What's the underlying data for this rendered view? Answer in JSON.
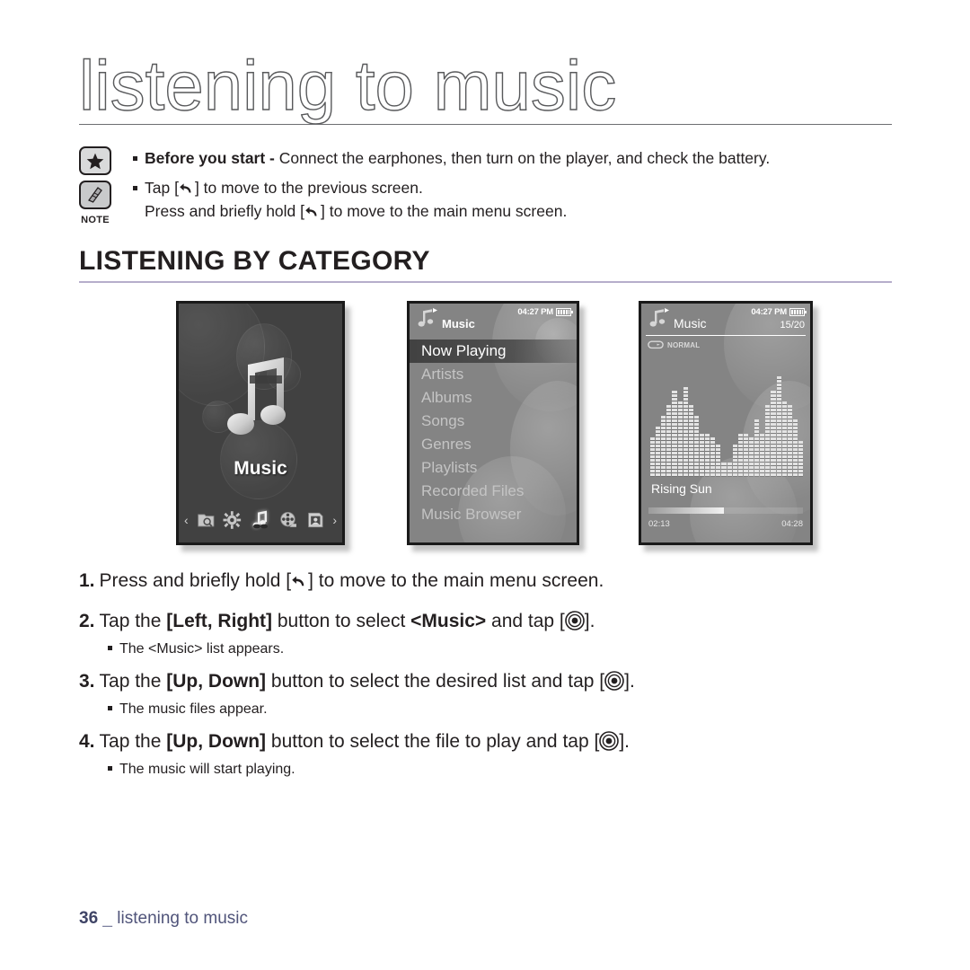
{
  "page": {
    "title": "listening to music",
    "section_heading": "LISTENING BY CATEGORY",
    "accent_rule_color": "#b6aecb"
  },
  "notes": {
    "caption": "NOTE",
    "star_icon": "star-icon",
    "pen_icon": "pen-note-icon",
    "items": [
      {
        "bold_lead": "Before you start -",
        "text": " Connect the earphones, then turn on the player, and check the battery."
      },
      {
        "pre": "Tap [",
        "post": "] to move to the previous screen.",
        "line2_pre": "Press and briefly hold [",
        "line2_post": "] to move to the main menu screen."
      }
    ]
  },
  "screens": {
    "main_menu": {
      "label": "Music",
      "icon_bar": [
        "folder-search-icon",
        "settings-gear-icon",
        "music-note-icon",
        "film-reel-icon",
        "picture-icon"
      ],
      "left_arrow": "‹",
      "right_arrow": "›",
      "background_color": "#414141"
    },
    "music_list": {
      "header_title": "Music",
      "clock": "04:27 PM",
      "items": [
        "Now Playing",
        "Artists",
        "Albums",
        "Songs",
        "Genres",
        "Playlists",
        "Recorded Files",
        "Music Browser"
      ],
      "selected_index": 0,
      "background_color": "#848484"
    },
    "now_playing": {
      "header_title": "Music",
      "clock": "04:27 PM",
      "track_count": "15/20",
      "repeat_mode": "NORMAL",
      "repeat_icon": "repeat-icon",
      "track_title": "Rising Sun",
      "elapsed_time": "02:13",
      "total_time": "04:28",
      "progress_percent": 49,
      "equalizer_levels": [
        11,
        14,
        17,
        20,
        24,
        21,
        25,
        20,
        17,
        12,
        12,
        11,
        9,
        4,
        4,
        9,
        12,
        12,
        11,
        16,
        12,
        20,
        24,
        28,
        21,
        20,
        16,
        10
      ]
    }
  },
  "steps": [
    {
      "num": "1.",
      "parts": [
        {
          "t": "Press and briefly hold [",
          "b": false
        },
        {
          "t": "BACK_ICON",
          "b": false
        },
        {
          "t": "] to move to the main menu screen.",
          "b": false
        }
      ],
      "sub": null
    },
    {
      "num": "2.",
      "parts": [
        {
          "t": "Tap the ",
          "b": false
        },
        {
          "t": "[Left, Right]",
          "b": true
        },
        {
          "t": " button to select ",
          "b": false
        },
        {
          "t": "<Music>",
          "b": true
        },
        {
          "t": " and tap [",
          "b": false
        },
        {
          "t": "OK_ICON",
          "b": false
        },
        {
          "t": "].",
          "b": false
        }
      ],
      "sub": "The <Music> list appears."
    },
    {
      "num": "3.",
      "parts": [
        {
          "t": "Tap the ",
          "b": false
        },
        {
          "t": "[Up, Down]",
          "b": true
        },
        {
          "t": " button to select the desired list and tap [",
          "b": false
        },
        {
          "t": "OK_ICON",
          "b": false
        },
        {
          "t": "].",
          "b": false
        }
      ],
      "sub": "The music files appear."
    },
    {
      "num": "4.",
      "parts": [
        {
          "t": "Tap the ",
          "b": false
        },
        {
          "t": "[Up, Down]",
          "b": true
        },
        {
          "t": " button to select the file to play and tap [",
          "b": false
        },
        {
          "t": "OK_ICON",
          "b": false
        },
        {
          "t": "].",
          "b": false
        }
      ],
      "sub": "The music will start playing."
    }
  ],
  "footer": {
    "page_number": "36",
    "separator": "_",
    "text": "listening to music"
  }
}
